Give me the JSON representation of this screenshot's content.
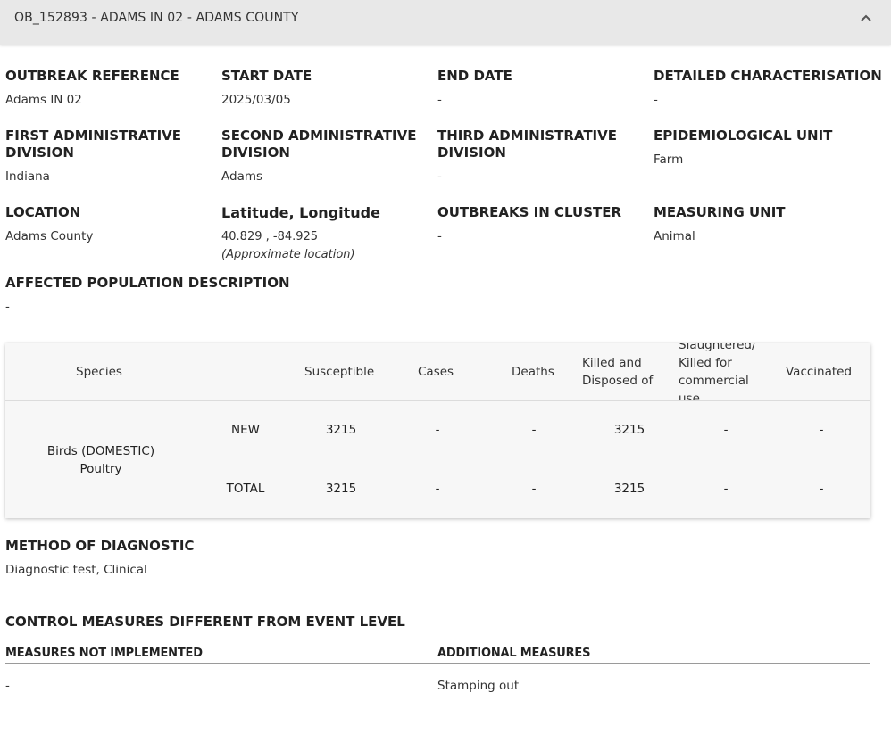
{
  "header": {
    "title": "OB_152893 - ADAMS IN 02 - ADAMS COUNTY",
    "collapse_icon": "chevron-up-icon"
  },
  "fields": {
    "outbreak_reference": {
      "label": "OUTBREAK REFERENCE",
      "value": "Adams IN 02"
    },
    "start_date": {
      "label": "START DATE",
      "value": "2025/03/05"
    },
    "end_date": {
      "label": "END DATE",
      "value": "-"
    },
    "detailed_characterisation": {
      "label": "DETAILED CHARACTERISATION",
      "value": "-"
    },
    "first_admin": {
      "label_line1": "FIRST ADMINISTRATIVE",
      "label_line2": "DIVISION",
      "value": "Indiana"
    },
    "second_admin": {
      "label_line1": "SECOND ADMINISTRATIVE",
      "label_line2": "DIVISION",
      "value": "Adams"
    },
    "third_admin": {
      "label_line1": "THIRD ADMINISTRATIVE",
      "label_line2": "DIVISION",
      "value": "-"
    },
    "epi_unit": {
      "label": "EPIDEMIOLOGICAL UNIT",
      "value": "Farm"
    },
    "location": {
      "label": "LOCATION",
      "value": "Adams County"
    },
    "lat_long": {
      "label": "Latitude, Longitude",
      "value": "40.829 , -84.925",
      "note": "(Approximate location)"
    },
    "outbreaks_in_cluster": {
      "label": "OUTBREAKS IN CLUSTER",
      "value": "-"
    },
    "measuring_unit": {
      "label": "MEASURING UNIT",
      "value": "Animal"
    },
    "affected_population": {
      "label": "AFFECTED POPULATION DESCRIPTION",
      "value": "-"
    }
  },
  "table": {
    "headers": {
      "species": "Species",
      "susceptible": "Susceptible",
      "cases": "Cases",
      "deaths": "Deaths",
      "killed_line1": "Killed and",
      "killed_line2": "Disposed of",
      "slaughtered_line1": "Slaughtered/",
      "slaughtered_line2": "Killed for",
      "slaughtered_line3": "commercial",
      "slaughtered_line4": "use",
      "vaccinated": "Vaccinated"
    },
    "species_line1": "Birds (DOMESTIC)",
    "species_line2": "Poultry",
    "rows": [
      {
        "type": "NEW",
        "susceptible": "3215",
        "cases": "-",
        "deaths": "-",
        "killed": "3215",
        "slaughtered": "-",
        "vaccinated": "-"
      },
      {
        "type": "TOTAL",
        "susceptible": "3215",
        "cases": "-",
        "deaths": "-",
        "killed": "3215",
        "slaughtered": "-",
        "vaccinated": "-"
      }
    ]
  },
  "diagnostic": {
    "label": "METHOD OF DIAGNOSTIC",
    "value": "Diagnostic test, Clinical"
  },
  "control_measures": {
    "title": "CONTROL MEASURES DIFFERENT FROM EVENT LEVEL",
    "not_implemented_label": "MEASURES NOT IMPLEMENTED",
    "not_implemented_value": "-",
    "additional_label": "ADDITIONAL MEASURES",
    "additional_value": "Stamping out"
  }
}
